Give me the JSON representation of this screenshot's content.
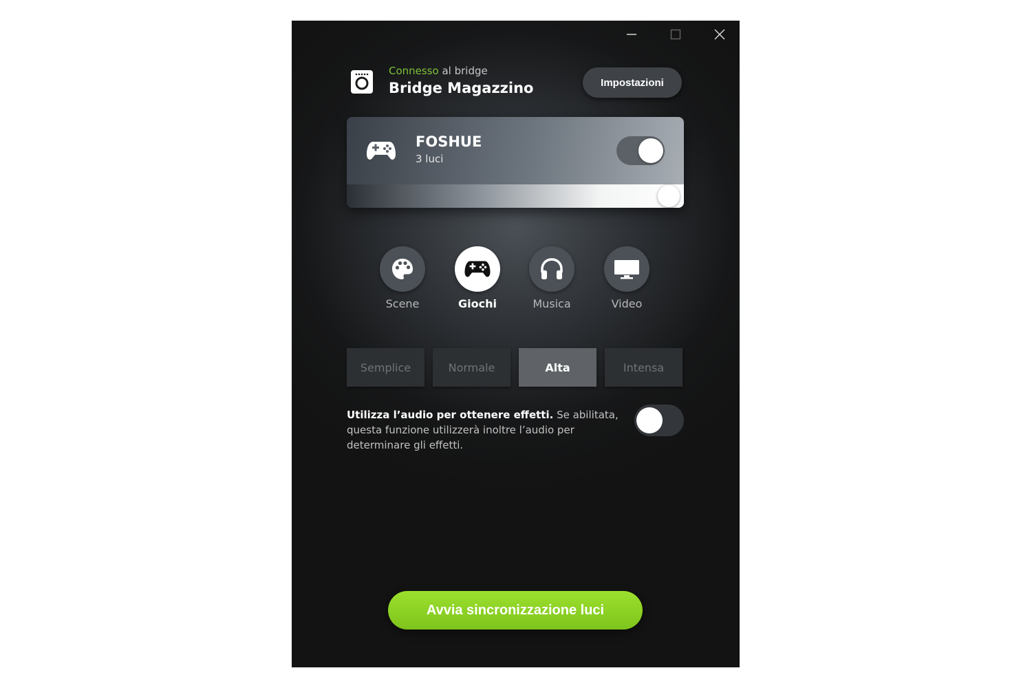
{
  "window_controls": {
    "minimize": "minimize-icon",
    "maximize": "maximize-icon",
    "close": "close-icon"
  },
  "bridge": {
    "status_accent": "Connesso",
    "status_rest": " al bridge",
    "name": "Bridge Magazzino",
    "icon": "bridge-icon"
  },
  "settings_button": {
    "label": "Impostazioni"
  },
  "entertainment_area": {
    "title": "FOSHUE",
    "subtitle": "3 luci",
    "icon": "gamepad-icon",
    "enabled": true,
    "brightness_percent": 100
  },
  "modes": [
    {
      "label": "Scene",
      "icon": "palette-icon",
      "active": false
    },
    {
      "label": "Giochi",
      "icon": "gamepad-icon",
      "active": true
    },
    {
      "label": "Musica",
      "icon": "headphones-icon",
      "active": false
    },
    {
      "label": "Video",
      "icon": "monitor-icon",
      "active": false
    }
  ],
  "intensity": [
    {
      "label": "Semplice",
      "active": false
    },
    {
      "label": "Normale",
      "active": false
    },
    {
      "label": "Alta",
      "active": true
    },
    {
      "label": "Intensa",
      "active": false
    }
  ],
  "audio_option": {
    "title": "Utilizza l’audio per ottenere effetti.",
    "description": " Se abilitata, questa funzione utilizzerà inoltre l’audio per determinare gli effetti.",
    "enabled": false
  },
  "start_button": {
    "label": "Avvia sincronizzazione luci"
  },
  "colors": {
    "accent": "#7ec23a",
    "button_green": "#8fd126",
    "background": "#161718"
  }
}
